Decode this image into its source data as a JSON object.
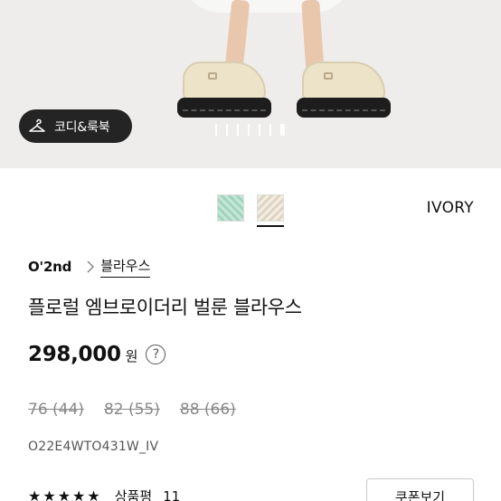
{
  "hero": {
    "look_button_label": "코디&룩북",
    "look_button_icon": "hanger-icon",
    "carousel_count": 7,
    "carousel_active_index": 6
  },
  "options": {
    "swatches": [
      "mint",
      "ivory"
    ],
    "selected_swatch": "ivory",
    "selected_color_name": "IVORY"
  },
  "product": {
    "brand": "O'2nd",
    "category": "블라우스",
    "title": "플로럴 엠브로이더리 벌룬 블라우스",
    "price": "298,000",
    "currency": "원",
    "help_icon": "question-circle-icon",
    "sizes": [
      "76 (44)",
      "82 (55)",
      "88 (66)"
    ],
    "product_code": "O22E4WTO431W_IV"
  },
  "reviews": {
    "rating": 4.5,
    "stars_text": "★★★★★",
    "label": "상품평",
    "count": "11"
  },
  "coupon": {
    "button_label": "쿠폰보기"
  }
}
